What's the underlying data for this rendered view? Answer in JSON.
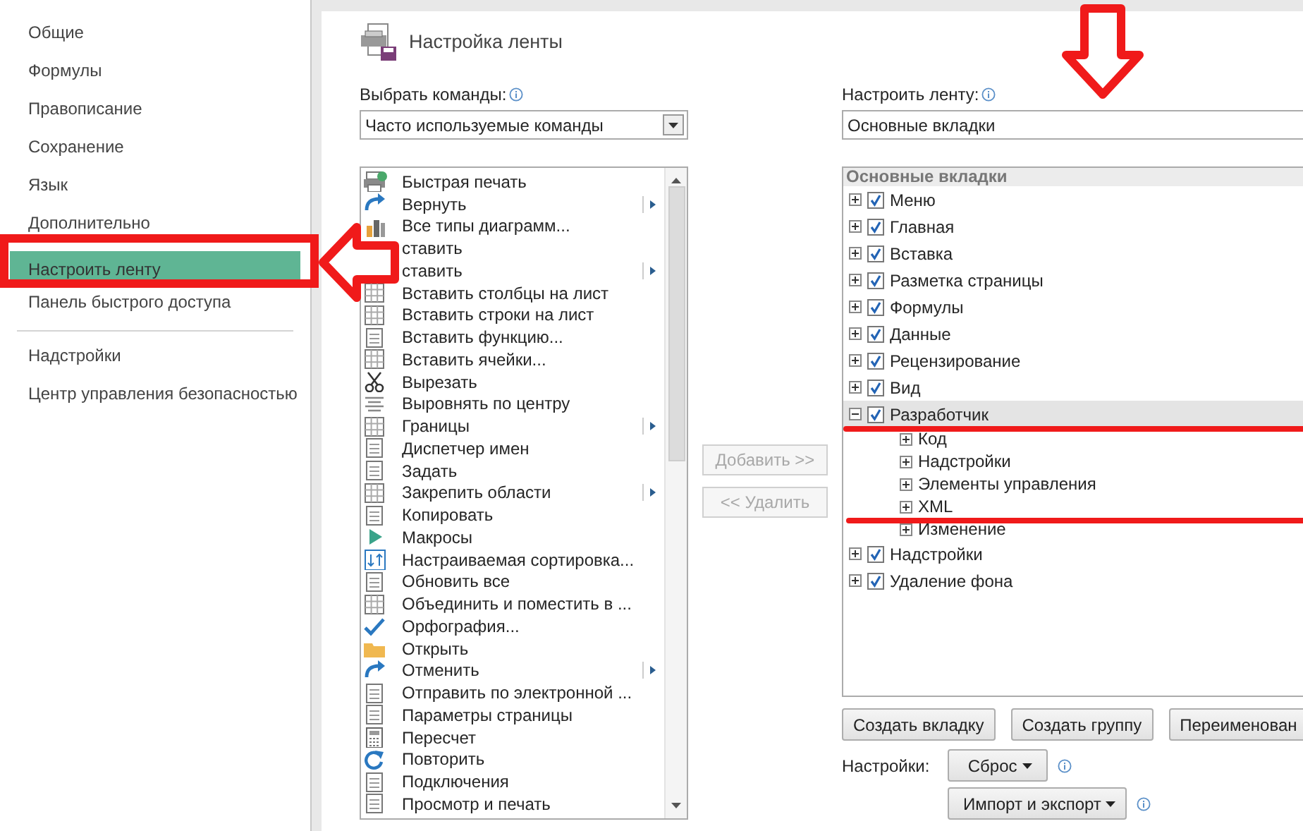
{
  "sidebar": {
    "items": [
      {
        "label": "Общие",
        "selected": false
      },
      {
        "label": "Формулы",
        "selected": false
      },
      {
        "label": "Правописание",
        "selected": false
      },
      {
        "label": "Сохранение",
        "selected": false
      },
      {
        "label": "Язык",
        "selected": false
      },
      {
        "label": "Дополнительно",
        "selected": false
      },
      {
        "label": "Настроить ленту",
        "selected": true
      },
      {
        "label": "Панель быстрого доступа",
        "selected": false,
        "divider_after": true
      },
      {
        "label": "Надстройки",
        "selected": false
      },
      {
        "label": "Центр управления безопасностью",
        "selected": false
      }
    ]
  },
  "title": "Настройка ленты",
  "commands": {
    "label": "Выбрать команды:",
    "value": "Часто используемые команды",
    "items": [
      {
        "label": "Быстрая печать",
        "submenu": false
      },
      {
        "label": "Вернуть",
        "submenu": true
      },
      {
        "label": "Все типы диаграмм...",
        "submenu": false
      },
      {
        "label": "ставить",
        "submenu": false
      },
      {
        "label": "ставить",
        "submenu": true
      },
      {
        "label": "Вставить столбцы на лист",
        "submenu": false
      },
      {
        "label": "Вставить строки на лист",
        "submenu": false
      },
      {
        "label": "Вставить функцию...",
        "submenu": false
      },
      {
        "label": "Вставить ячейки...",
        "submenu": false
      },
      {
        "label": "Вырезать",
        "submenu": false
      },
      {
        "label": "Выровнять по центру",
        "submenu": false
      },
      {
        "label": "Границы",
        "submenu": true
      },
      {
        "label": "Диспетчер имен",
        "submenu": false
      },
      {
        "label": "Задать",
        "submenu": false
      },
      {
        "label": "Закрепить области",
        "submenu": true
      },
      {
        "label": "Копировать",
        "submenu": false
      },
      {
        "label": "Макросы",
        "submenu": false
      },
      {
        "label": "Настраиваемая сортировка...",
        "submenu": false
      },
      {
        "label": "Обновить все",
        "submenu": false
      },
      {
        "label": "Объединить и поместить в ...",
        "submenu": false
      },
      {
        "label": "Орфография...",
        "submenu": false
      },
      {
        "label": "Открыть",
        "submenu": false
      },
      {
        "label": "Отменить",
        "submenu": true
      },
      {
        "label": "Отправить по электронной ...",
        "submenu": false
      },
      {
        "label": "Параметры страницы",
        "submenu": false
      },
      {
        "label": "Пересчет",
        "submenu": false
      },
      {
        "label": "Повторить",
        "submenu": false
      },
      {
        "label": "Подключения",
        "submenu": false
      },
      {
        "label": "Просмотр и печать",
        "submenu": false
      }
    ]
  },
  "transfer_buttons": [
    {
      "label": "Добавить >>",
      "disabled": true
    },
    {
      "label": "<< Удалить",
      "disabled": true
    }
  ],
  "ribbon": {
    "label": "Настроить ленту:",
    "value": "Основные вкладки",
    "tree_header": "Основные вкладки",
    "tabs": [
      {
        "label": "Меню",
        "checked": true,
        "expanded": false,
        "selected": false
      },
      {
        "label": "Главная",
        "checked": true,
        "expanded": false,
        "selected": false
      },
      {
        "label": "Вставка",
        "checked": true,
        "expanded": false,
        "selected": false
      },
      {
        "label": "Разметка страницы",
        "checked": true,
        "expanded": false,
        "selected": false
      },
      {
        "label": "Формулы",
        "checked": true,
        "expanded": false,
        "selected": false
      },
      {
        "label": "Данные",
        "checked": true,
        "expanded": false,
        "selected": false
      },
      {
        "label": "Рецензирование",
        "checked": true,
        "expanded": false,
        "selected": false
      },
      {
        "label": "Вид",
        "checked": true,
        "expanded": false,
        "selected": false
      },
      {
        "label": "Разработчик",
        "checked": true,
        "expanded": true,
        "selected": true,
        "children": [
          {
            "label": "Код",
            "expanded": false
          },
          {
            "label": "Надстройки",
            "expanded": false
          },
          {
            "label": "Элементы управления",
            "expanded": false
          },
          {
            "label": "XML",
            "expanded": false
          },
          {
            "label": "Изменение",
            "expanded": false
          }
        ]
      },
      {
        "label": "Надстройки",
        "checked": true,
        "expanded": false,
        "selected": false
      },
      {
        "label": "Удаление фона",
        "checked": true,
        "expanded": false,
        "selected": false
      }
    ],
    "buttons": [
      "Создать вкладку",
      "Создать группу",
      "Переименован"
    ],
    "settings_label": "Настройки:",
    "reset_button": "Сброс",
    "import_button": "Импорт и экспорт"
  }
}
